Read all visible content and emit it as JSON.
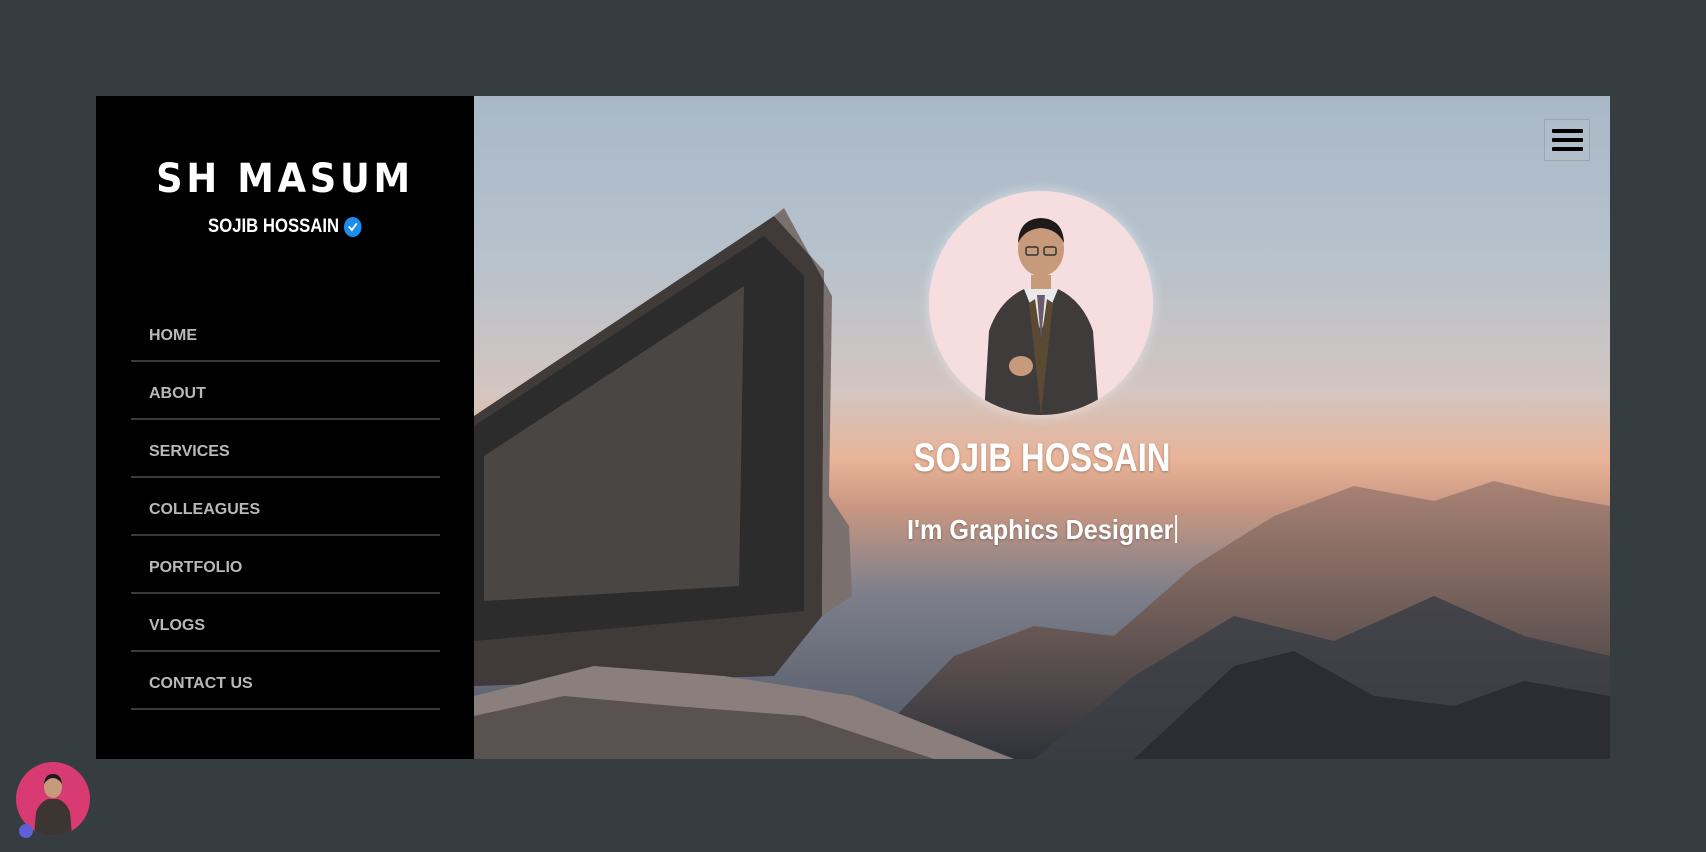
{
  "sidebar": {
    "brand": "SH MASUM",
    "subtitle": "SOJIB HOSSAIN",
    "nav": [
      "HOME",
      "ABOUT",
      "SERVICES",
      "COLLEAGUES",
      "PORTFOLIO",
      "VLOGS",
      "CONTACT US"
    ]
  },
  "hero": {
    "name": "SOJIB HOSSAIN",
    "role": "I'm Graphics Designer",
    "menu_icon": "hamburger-icon"
  },
  "colors": {
    "page_bg": "#353d40",
    "sidebar_bg": "#000000",
    "verified_badge": "#1d8cf0",
    "nav_text": "#b9b9b9",
    "chat_bubble": "#d83a72"
  }
}
